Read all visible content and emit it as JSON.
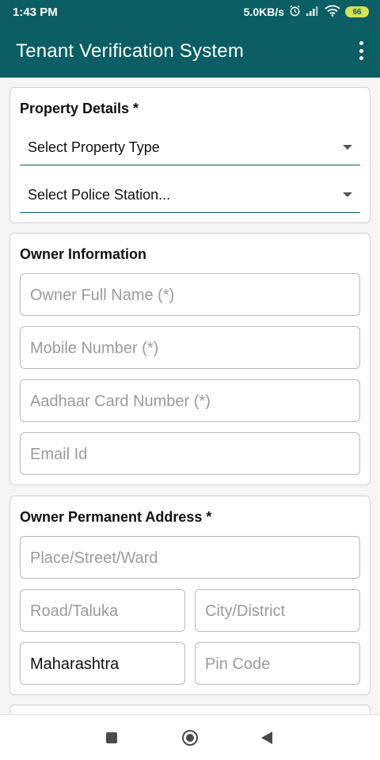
{
  "status_bar": {
    "time": "1:43 PM",
    "network_speed": "5.0KB/s",
    "battery": "66",
    "icons": [
      "alarm-icon",
      "signal-icon",
      "wifi-icon",
      "battery-icon"
    ]
  },
  "app_bar": {
    "title": "Tenant Verification System",
    "menu_icon": "more-vert-icon"
  },
  "property_details": {
    "title": "Property Details *",
    "property_type_select": "Select Property Type",
    "police_station_select": "Select Police Station..."
  },
  "owner_information": {
    "title": "Owner Information",
    "full_name_placeholder": "Owner Full Name (*)",
    "mobile_placeholder": "Mobile Number (*)",
    "aadhaar_placeholder": "Aadhaar Card Number (*)",
    "email_placeholder": "Email Id"
  },
  "owner_address": {
    "title": "Owner Permanent Address *",
    "street_placeholder": "Place/Street/Ward",
    "road_placeholder": "Road/Taluka",
    "city_placeholder": "City/District",
    "state_value": "Maharashtra",
    "pin_placeholder": "Pin Code"
  },
  "nav_bar": {
    "icons": [
      "recents-icon",
      "home-icon",
      "back-icon"
    ]
  },
  "colors": {
    "primary": "#0b5e63",
    "card_border": "#cfcfcf",
    "placeholder": "#9a9a9a"
  }
}
